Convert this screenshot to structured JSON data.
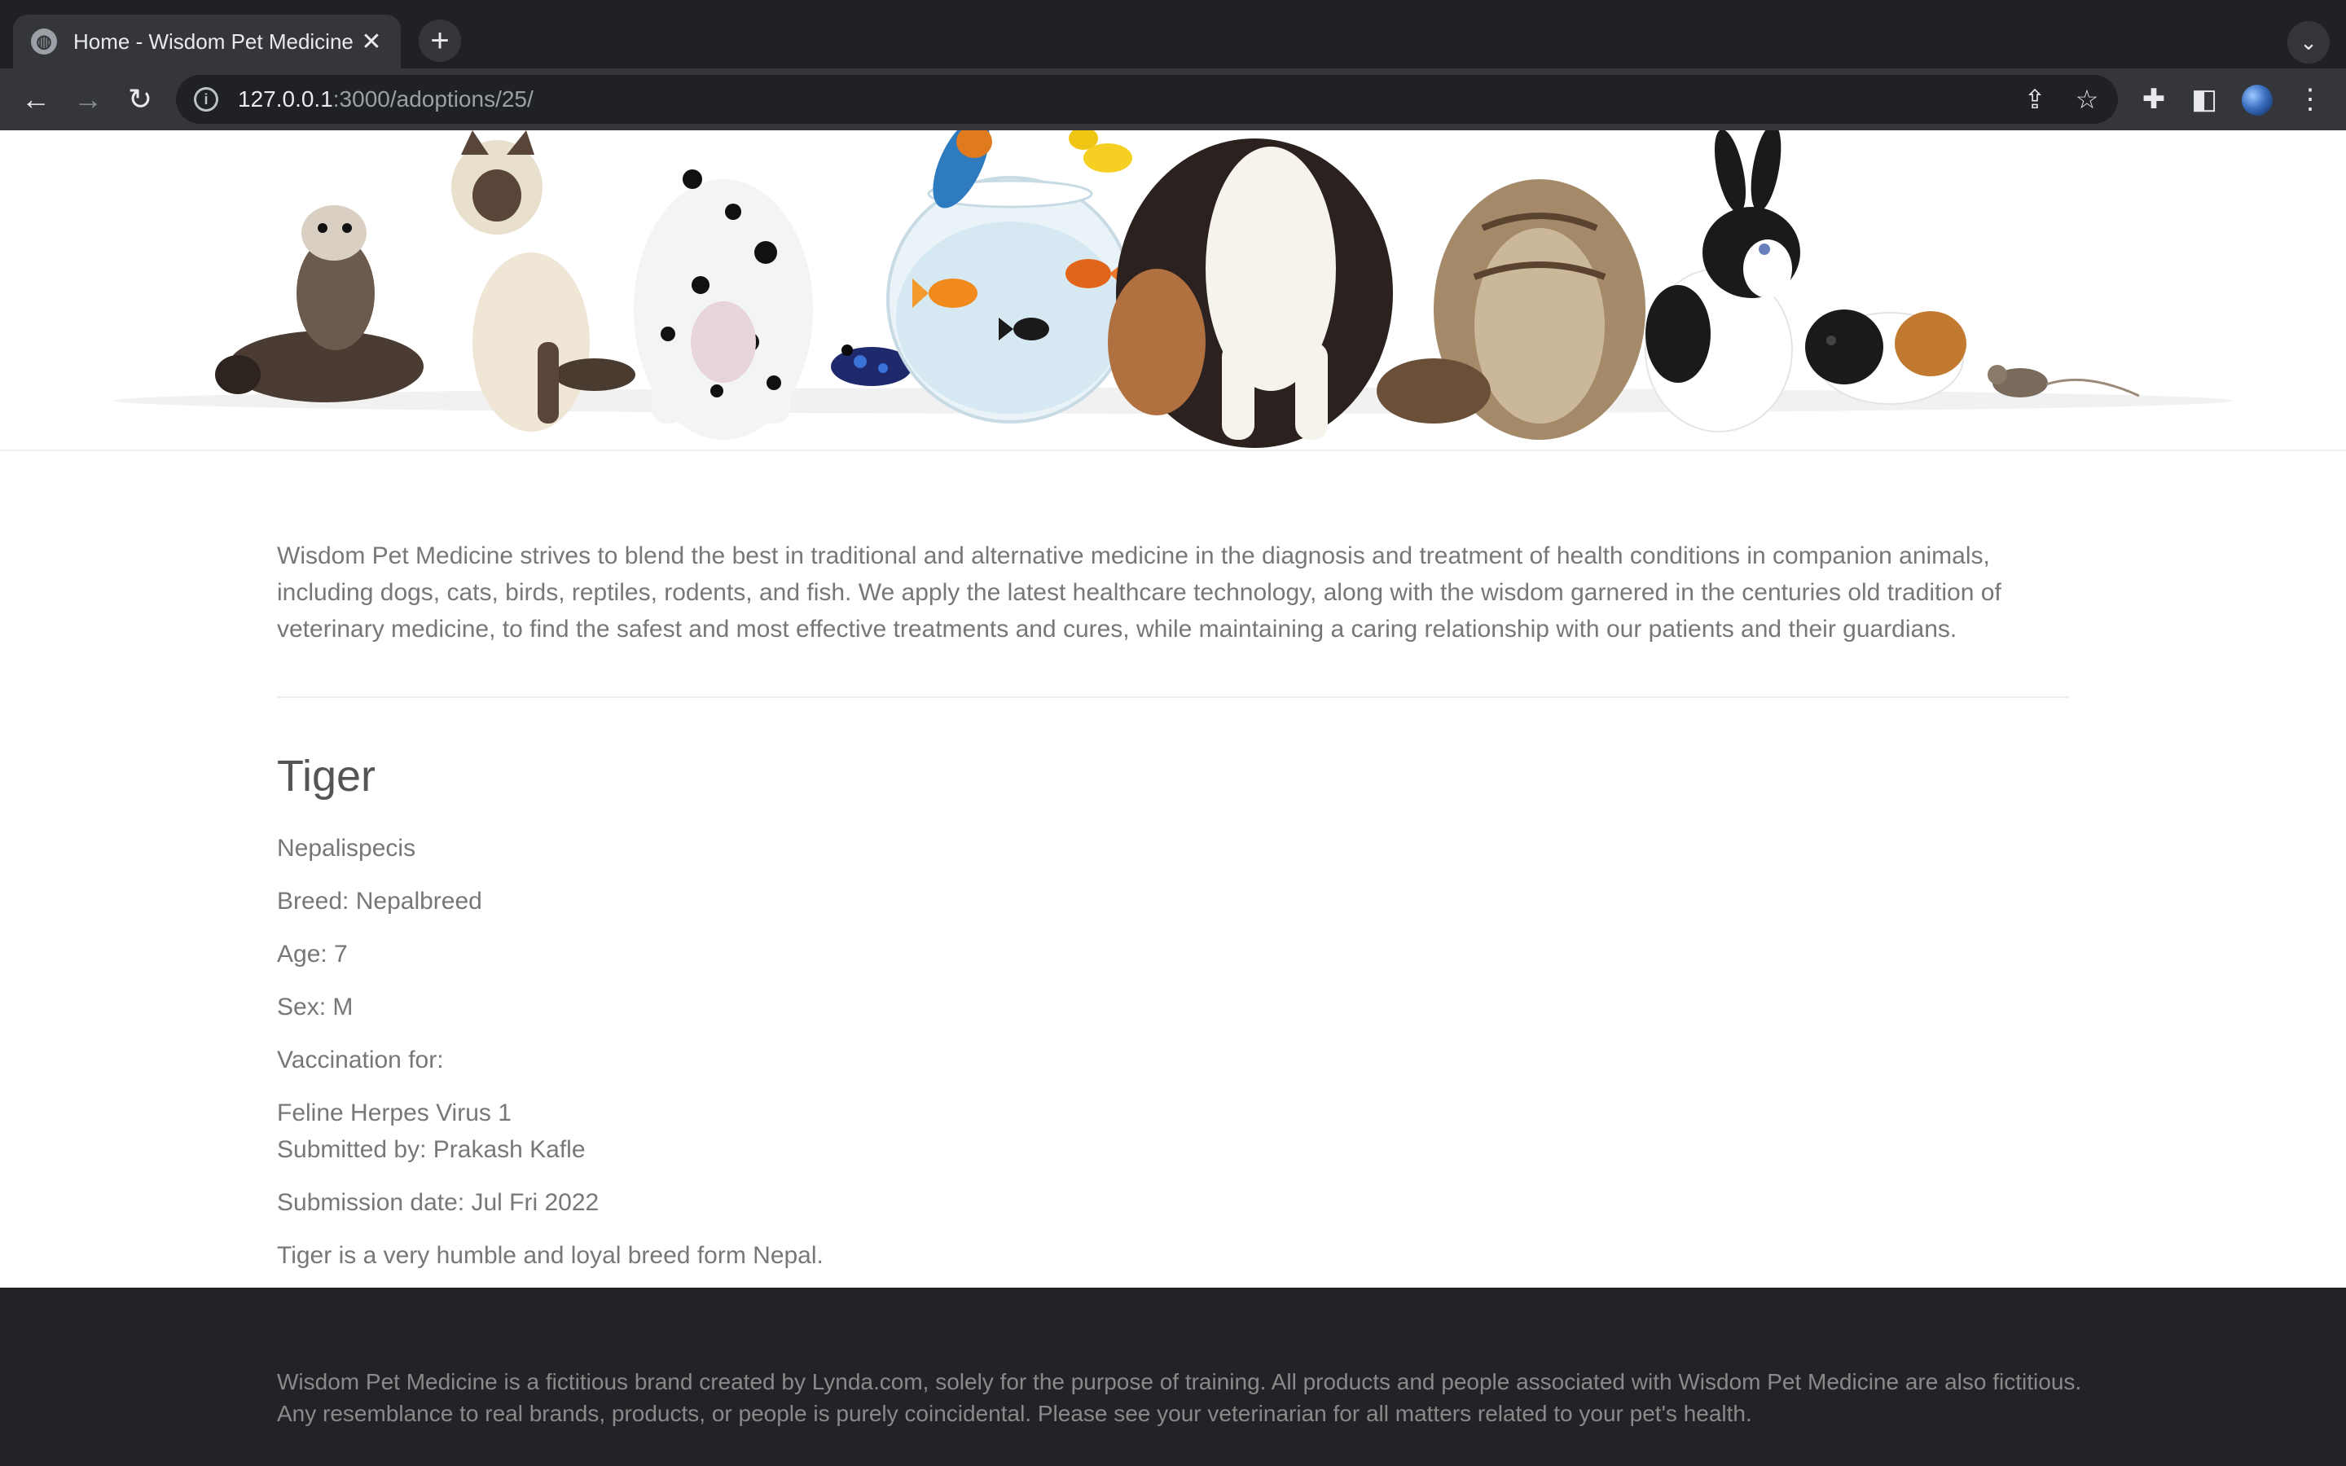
{
  "browser": {
    "tab_title": "Home - Wisdom Pet Medicine",
    "url_host": "127.0.0.1",
    "url_rest": ":3000/adoptions/25/"
  },
  "intro": "Wisdom Pet Medicine strives to blend the best in traditional and alternative medicine in the diagnosis and treatment of health conditions in companion animals, including dogs, cats, birds, reptiles, rodents, and fish. We apply the latest healthcare technology, along with the wisdom garnered in the centuries old tradition of veterinary medicine, to find the safest and most effective treatments and cures, while maintaining a caring relationship with our patients and their guardians.",
  "pet": {
    "name": "Tiger",
    "species": "Nepalispecis",
    "breed": "Breed: Nepalbreed",
    "age": "Age: 7",
    "sex": "Sex: M",
    "vaccination_label": "Vaccination for:",
    "vaccination": "Feline Herpes Virus 1",
    "submitted_by": "Submitted by: Prakash Kafle",
    "submission_date": "Submission date: Jul Fri 2022",
    "description": "Tiger is a very humble and loyal breed form Nepal."
  },
  "footer": {
    "text": "Wisdom Pet Medicine is a fictitious brand created by Lynda.com, solely for the purpose of training. All products and people associated with Wisdom Pet Medicine are also fictitious. Any resemblance to real brands, products, or people is purely coincidental. Please see your veterinarian for all matters related to your pet's health."
  }
}
